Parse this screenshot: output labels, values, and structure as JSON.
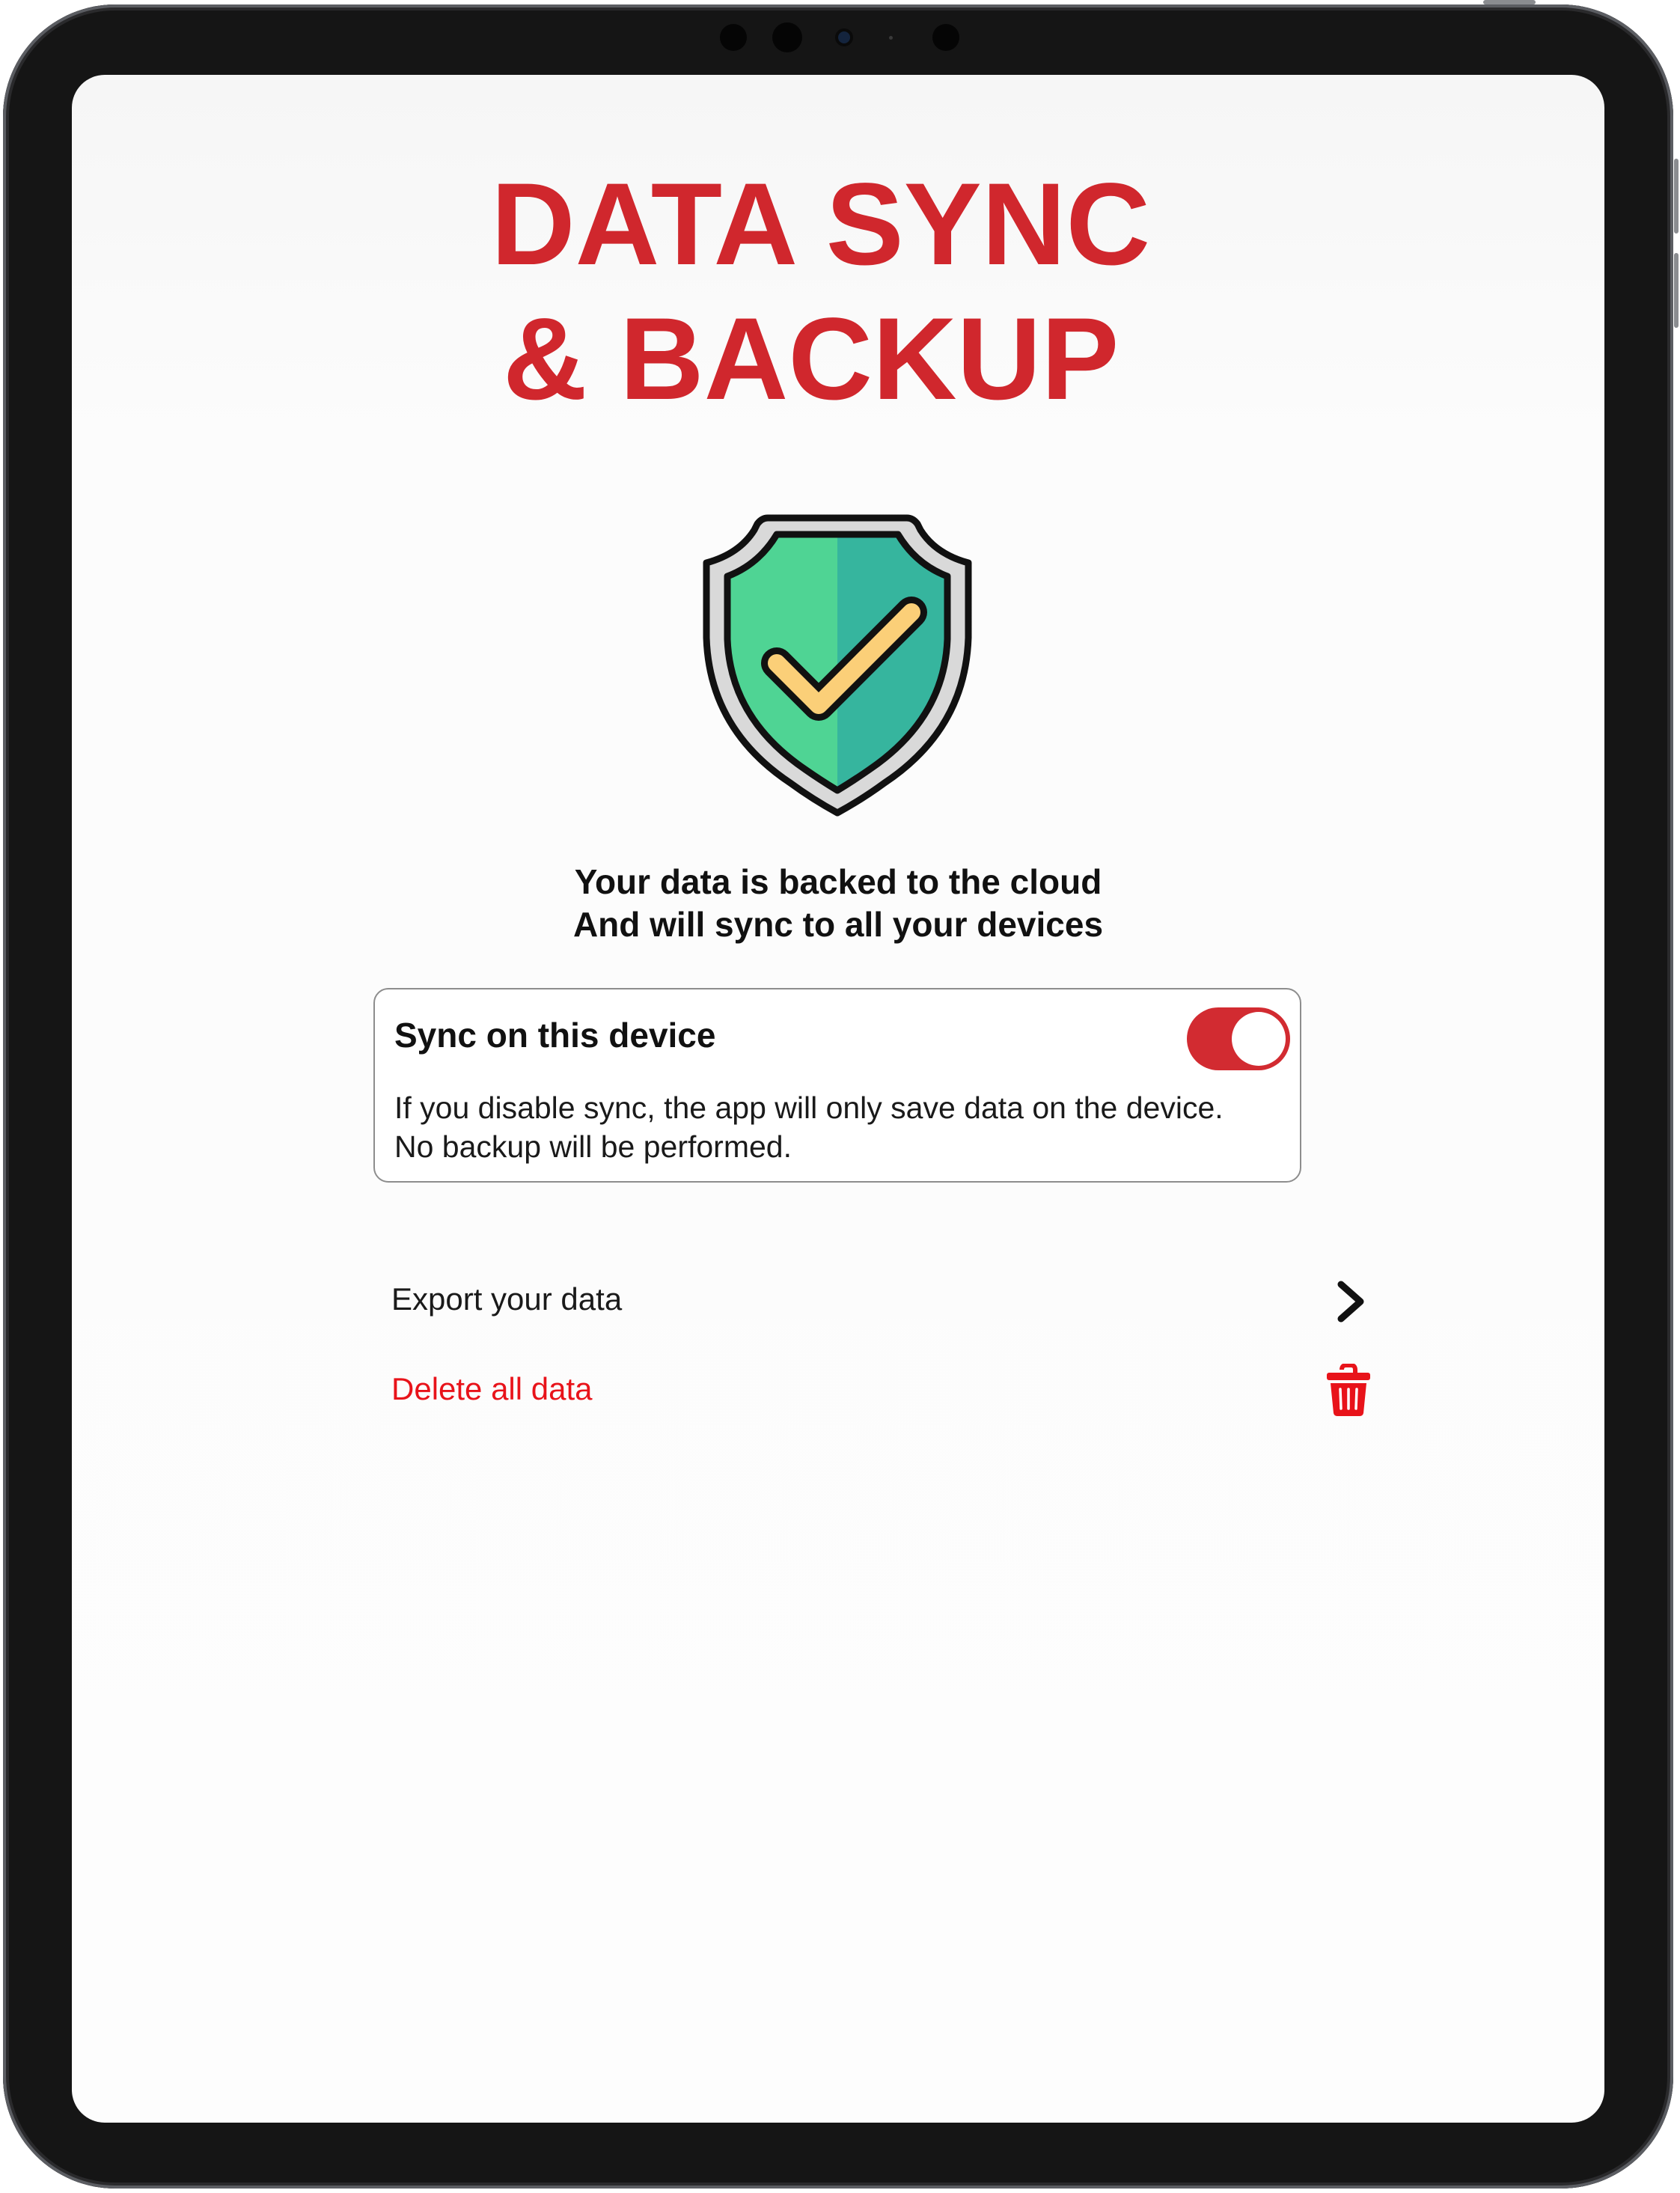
{
  "screen": {
    "title_line1": "DATA SYNC",
    "title_line2": "& BACKUP",
    "hero_icon": "shield-check-icon",
    "subtitle_line1": "Your data is backed to the cloud",
    "subtitle_line2": "And will sync to all your devices"
  },
  "sync_card": {
    "title": "Sync on this device",
    "toggle_on": true,
    "description_line1": "If you disable sync, the app will only save data on the device.",
    "description_line2": "No backup will be performed."
  },
  "actions": {
    "export_label": "Export your data",
    "export_icon": "chevron-right-icon",
    "delete_label": "Delete all data",
    "delete_icon": "trash-icon"
  },
  "colors": {
    "accent": "#d0272d",
    "toggle": "#d22b31",
    "destructive": "#e8131a",
    "shield_left": "#4fd494",
    "shield_right": "#36b59e",
    "checkmark": "#fbcf78"
  }
}
